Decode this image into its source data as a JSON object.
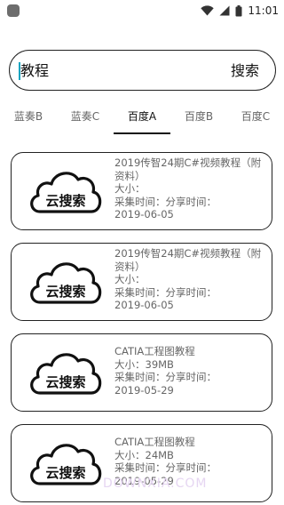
{
  "status_bar": {
    "time": "11:01",
    "icons": [
      "app-notification-icon",
      "wifi-icon",
      "cellular-signal-icon",
      "battery-icon"
    ]
  },
  "search": {
    "value": "教程",
    "button_label": "搜索"
  },
  "tabs": [
    {
      "label": "蓝奏B",
      "active": false
    },
    {
      "label": "蓝奏C",
      "active": false
    },
    {
      "label": "百度A",
      "active": true
    },
    {
      "label": "百度B",
      "active": false
    },
    {
      "label": "百度C",
      "active": false
    }
  ],
  "results": [
    {
      "logo_text": "云搜索",
      "title": "2019传智24期C#视频教程（附资料）",
      "size_line": "大小：",
      "time_line": "采集时间：分享时间：",
      "date": "2019-06-05"
    },
    {
      "logo_text": "云搜索",
      "title": "2019传智24期C#视频教程（附资料）",
      "size_line": "大小：",
      "time_line": "采集时间：分享时间：",
      "date": "2019-06-05"
    },
    {
      "logo_text": "云搜索",
      "title": "CATIA工程图教程",
      "size_line": "大小：39MB",
      "time_line": "采集时间：分享时间：",
      "date": "2019-05-29"
    },
    {
      "logo_text": "云搜索",
      "title": "CATIA工程图教程",
      "size_line": "大小：24MB",
      "time_line": "采集时间：分享时间：",
      "date": "2019-05-29"
    }
  ],
  "watermark": "DOWNXIA.COM",
  "colors": {
    "accent_cursor": "#10a4c0",
    "border": "#222222",
    "muted_text": "#666666"
  }
}
